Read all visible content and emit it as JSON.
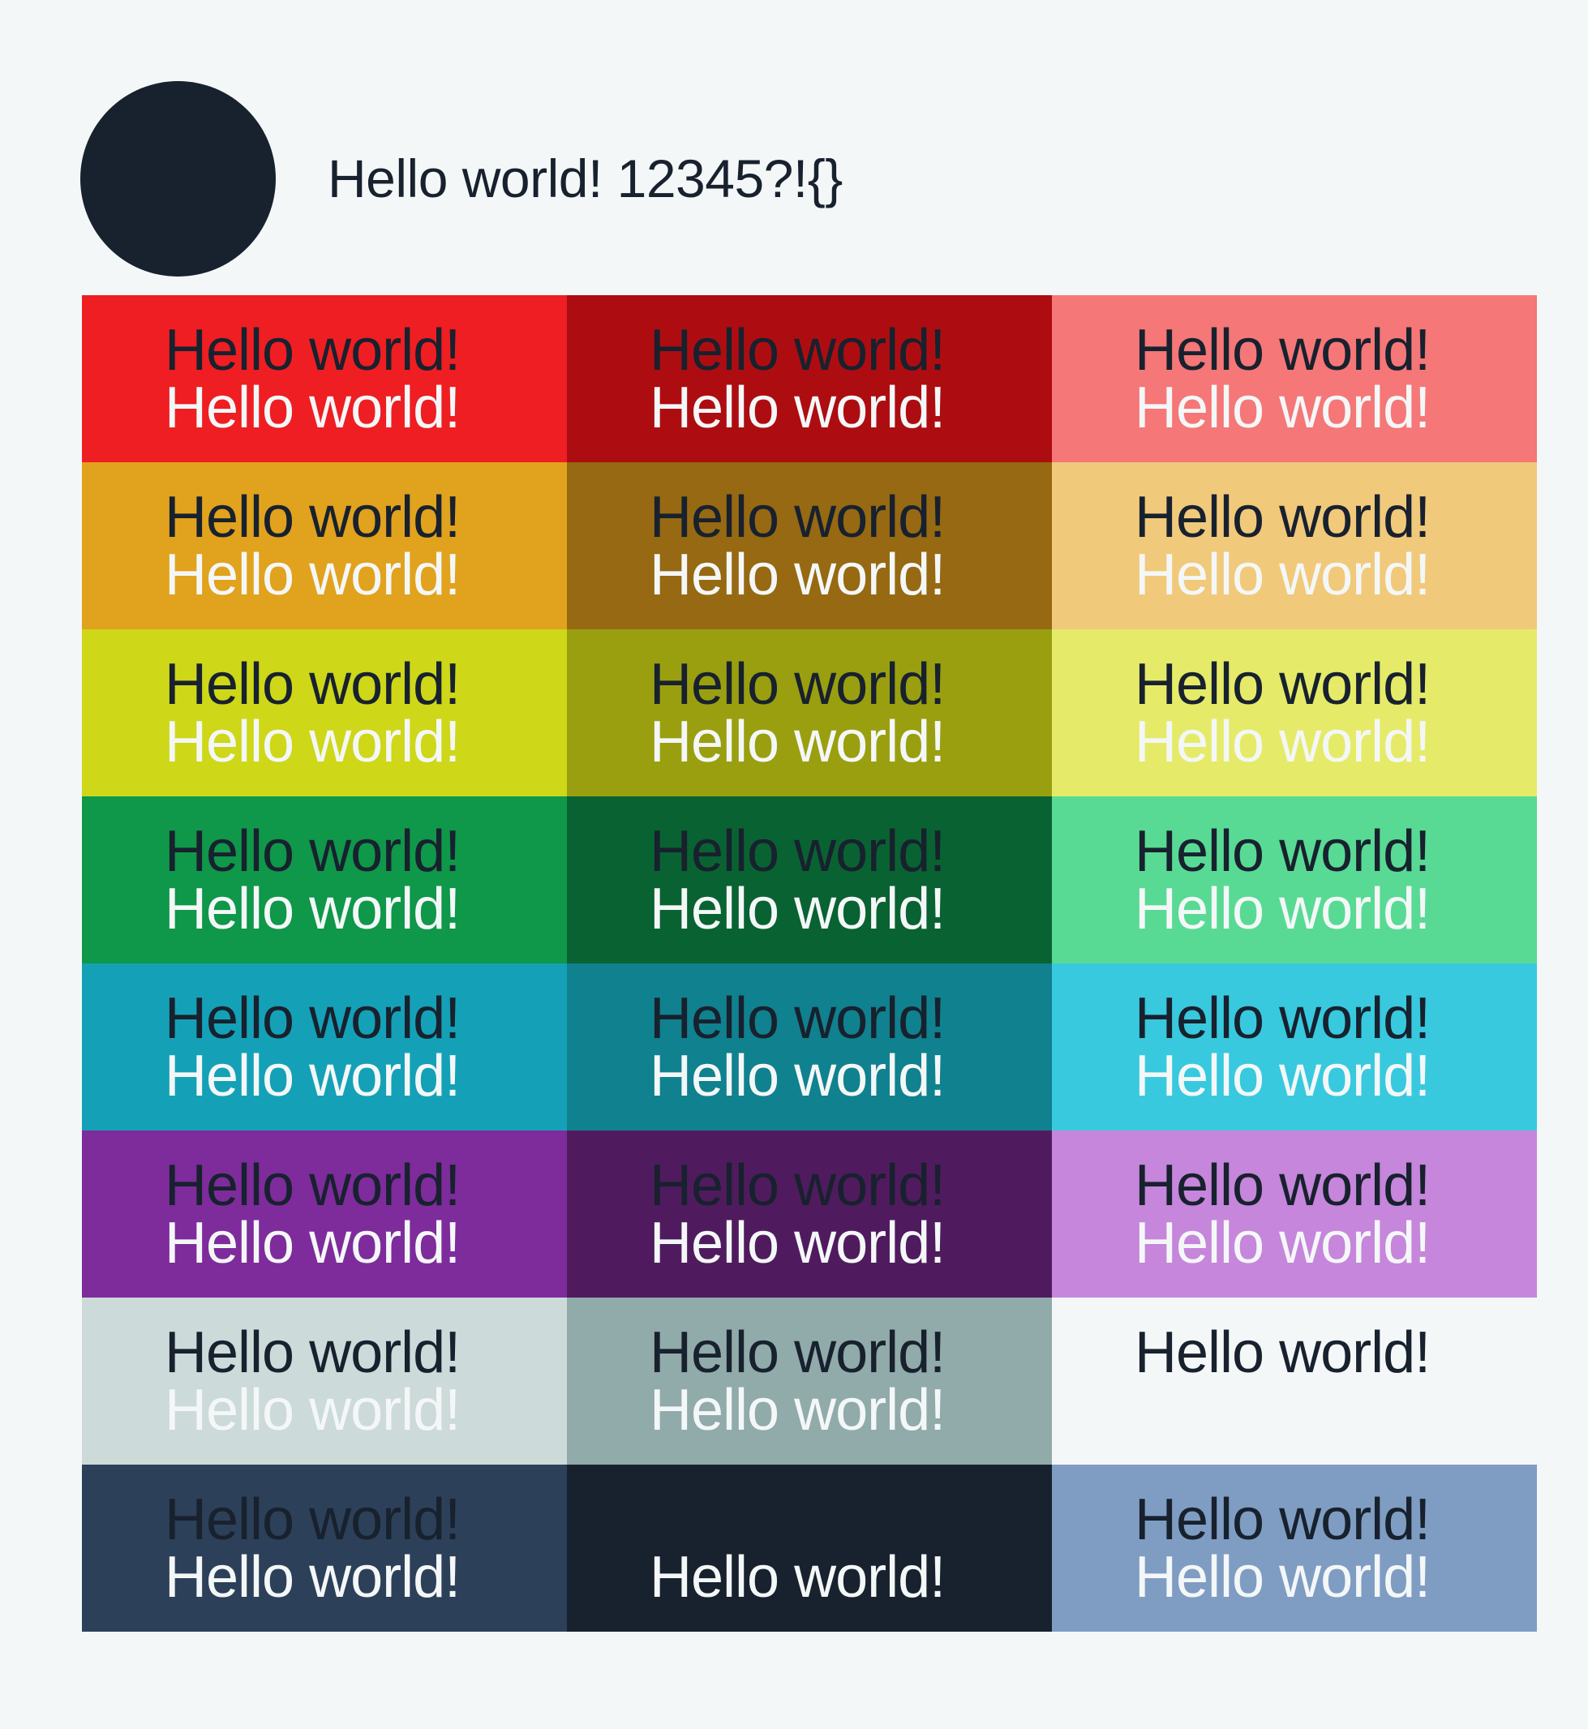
{
  "header": {
    "text": "Hello world! 12345?!{}",
    "text_color": "#18212e",
    "circle_color": "#18212e"
  },
  "colors": {
    "background": "#f4f7f7",
    "dark_text": "#18212e",
    "light_text": "#f4f7f7"
  },
  "swatches": [
    {
      "color": "#ee1e22",
      "dark_text": "Hello world!",
      "light_text": "Hello world!"
    },
    {
      "color": "#ad0d11",
      "dark_text": "Hello world!",
      "light_text": "Hello world!"
    },
    {
      "color": "#f57777",
      "dark_text": "Hello world!",
      "light_text": "Hello world!"
    },
    {
      "color": "#e1a21d",
      "dark_text": "Hello world!",
      "light_text": "Hello world!"
    },
    {
      "color": "#966912",
      "dark_text": "Hello world!",
      "light_text": "Hello world!"
    },
    {
      "color": "#f1c97a",
      "dark_text": "Hello world!",
      "light_text": "Hello world!"
    },
    {
      "color": "#ced718",
      "dark_text": "Hello world!",
      "light_text": "Hello world!"
    },
    {
      "color": "#9a9f10",
      "dark_text": "Hello world!",
      "light_text": "Hello world!"
    },
    {
      "color": "#e5eb68",
      "dark_text": "Hello world!",
      "light_text": "Hello world!"
    },
    {
      "color": "#0f974a",
      "dark_text": "Hello world!",
      "light_text": "Hello world!"
    },
    {
      "color": "#096232",
      "dark_text": "Hello world!",
      "light_text": "Hello world!"
    },
    {
      "color": "#58da94",
      "dark_text": "Hello world!",
      "light_text": "Hello world!"
    },
    {
      "color": "#14a1b7",
      "dark_text": "Hello world!",
      "light_text": "Hello world!"
    },
    {
      "color": "#10818e",
      "dark_text": "Hello world!",
      "light_text": "Hello world!"
    },
    {
      "color": "#38c9de",
      "dark_text": "Hello world!",
      "light_text": "Hello world!"
    },
    {
      "color": "#7e2b9c",
      "dark_text": "Hello world!",
      "light_text": "Hello world!"
    },
    {
      "color": "#4f1b5e",
      "dark_text": "Hello world!",
      "light_text": "Hello world!"
    },
    {
      "color": "#c586db",
      "dark_text": "Hello world!",
      "light_text": "Hello world!"
    },
    {
      "color": "#ccdad9",
      "dark_text": "Hello world!",
      "light_text": "Hello world!"
    },
    {
      "color": "#91aaaa",
      "dark_text": "Hello world!",
      "light_text": "Hello world!"
    },
    {
      "color": "#f4f7f7",
      "dark_text": "Hello world!",
      "light_text": ""
    },
    {
      "color": "#2d4059",
      "dark_text": "Hello world!",
      "light_text": "Hello world!"
    },
    {
      "color": "#18212e",
      "dark_text": "",
      "light_text": "Hello world!"
    },
    {
      "color": "#7f9dc2",
      "dark_text": "Hello world!",
      "light_text": "Hello world!"
    }
  ]
}
